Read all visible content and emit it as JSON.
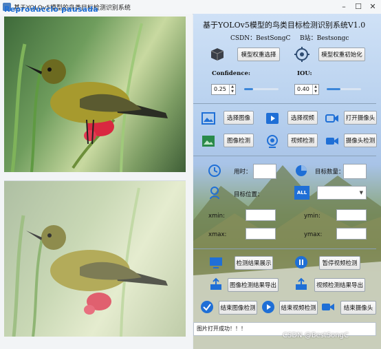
{
  "window": {
    "title": "基于YOLOv5模型的鸟类目标检测识别系统",
    "overlay_text": "Reproduccio pausada",
    "min": "–",
    "max": "☐",
    "close": "✕"
  },
  "header": {
    "title": "基于YOLOv5模型的鸟类目标检测识别系统V1.0",
    "csdn": "CSDN：BestSongC",
    "bilibili": "B站：Bestsongc"
  },
  "model": {
    "select_label": "模型权重选择",
    "init_label": "模型权重初始化"
  },
  "params": {
    "confidence_label": "Confidence:",
    "confidence_value": "0.25",
    "confidence_level": 0.25,
    "iou_label": "IOU:",
    "iou_value": "0.40",
    "iou_level": 0.4
  },
  "media": {
    "select_image": "选择图像",
    "select_video": "选择视频",
    "open_camera": "打开摄像头",
    "image_detect": "图像检测",
    "video_detect": "视频检测",
    "camera_detect": "摄像头检测"
  },
  "stats": {
    "time_label": "用时：",
    "count_label": "目标数量：",
    "position_label": "目标位置：",
    "xmin": "xmin:",
    "ymin": "ymin:",
    "xmax": "xmax:",
    "ymax": "ymax:"
  },
  "actions": {
    "show_results": "检测结果展示",
    "pause_video": "暂停视频检测",
    "export_image": "图像检测结果导出",
    "export_video": "视频检测结果导出",
    "end_image": "结束图像检测",
    "end_video": "结束视频检测",
    "end_camera": "结束摄像头"
  },
  "status_text": "图片打开成功！！！",
  "watermark": "CSDN @BestSongC",
  "colors": {
    "accent": "#3b86d8",
    "overlay": "#1f6fd6"
  }
}
